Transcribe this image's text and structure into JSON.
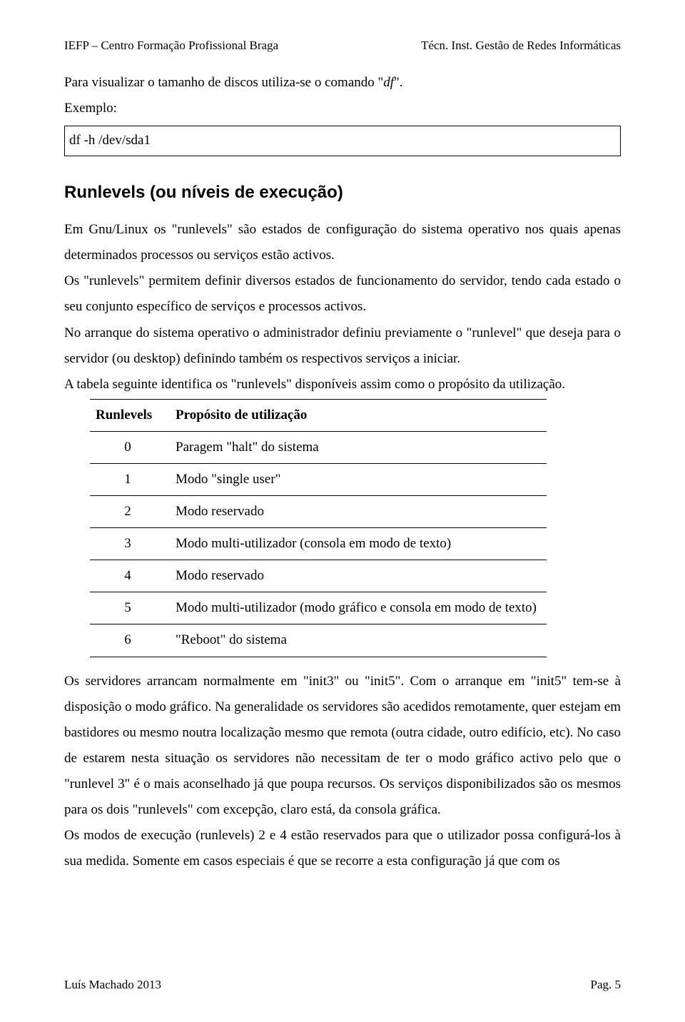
{
  "header": {
    "left": "IEFP – Centro Formação Profissional Braga",
    "right": "Técn. Inst. Gestão de Redes Informáticas"
  },
  "intro": {
    "line_prefix": "Para visualizar o tamanho de discos utiliza-se o comando \"",
    "cmd": "df",
    "line_suffix": "\".",
    "example_label": "Exemplo:"
  },
  "command_box": "df -h /dev/sda1",
  "section_title": "Runlevels (ou níveis de execução)",
  "body": {
    "p1": "Em Gnu/Linux os \"runlevels\" são estados de configuração do sistema operativo nos quais apenas determinados processos ou serviços estão activos.",
    "p2": "Os \"runlevels\" permitem definir diversos estados de funcionamento do servidor, tendo cada estado o seu conjunto específico de serviços e processos activos.",
    "p3": "No arranque do sistema operativo o administrador definiu previamente o \"runlevel\" que deseja para o servidor (ou desktop) definindo também os respectivos serviços a iniciar.",
    "p4": "A tabela seguinte identifica os \"runlevels\" disponíveis assim como o propósito da utilização."
  },
  "table": {
    "col1": "Runlevels",
    "col2": "Propósito de utilização",
    "rows": [
      {
        "level": "0",
        "desc": "Paragem \"halt\" do sistema"
      },
      {
        "level": "1",
        "desc": "Modo \"single user\""
      },
      {
        "level": "2",
        "desc": "Modo reservado"
      },
      {
        "level": "3",
        "desc": "Modo multi-utilizador (consola em modo de texto)"
      },
      {
        "level": "4",
        "desc": "Modo reservado"
      },
      {
        "level": "5",
        "desc": "Modo multi-utilizador (modo gráfico e consola em modo de texto)"
      },
      {
        "level": "6",
        "desc": "\"Reboot\" do sistema"
      }
    ]
  },
  "after": {
    "p1": "Os servidores arrancam normalmente em \"init3\" ou \"init5\". Com o arranque em \"init5\" tem-se à disposição o modo gráfico. Na generalidade os servidores são acedidos remotamente, quer estejam em bastidores ou mesmo noutra localização mesmo que remota (outra cidade, outro edifício, etc). No caso de estarem nesta situação os servidores não necessitam de ter o modo gráfico activo pelo que o \"runlevel 3\" é o mais aconselhado já que poupa recursos. Os serviços disponibilizados são os mesmos para os dois \"runlevels\" com excepção, claro está, da consola gráfica.",
    "p2": "Os modos de execução (runlevels) 2 e 4 estão reservados para que o utilizador possa configurá-los à sua medida. Somente em casos especiais é que se recorre a esta configuração já que com os"
  },
  "footer": {
    "left": "Luís Machado 2013",
    "right": "Pag. 5"
  }
}
